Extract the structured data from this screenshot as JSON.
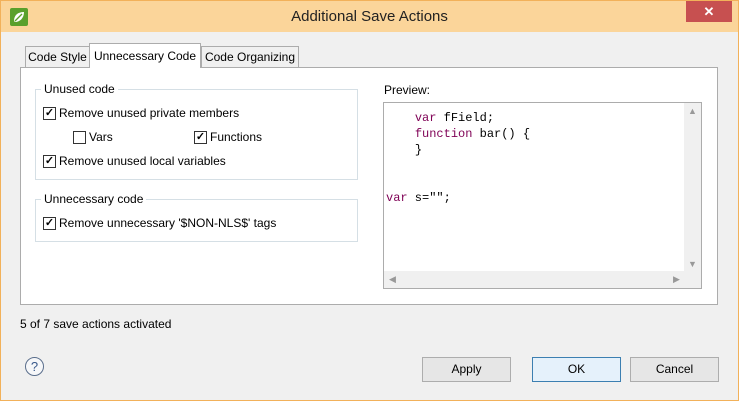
{
  "window": {
    "title": "Additional Save Actions",
    "close_glyph": "✕",
    "app_icon": "eclipse-leaf-icon"
  },
  "tabs": [
    {
      "label": "Code Style",
      "active": false
    },
    {
      "label": "Unnecessary Code",
      "active": true
    },
    {
      "label": "Code Organizing",
      "active": false
    }
  ],
  "unused_group": {
    "title": "Unused code",
    "remove_private": {
      "label": "Remove unused private members",
      "checked": true
    },
    "vars": {
      "label": "Vars",
      "checked": false
    },
    "functions": {
      "label": "Functions",
      "checked": true
    },
    "remove_locals": {
      "label": "Remove unused local variables",
      "checked": true
    }
  },
  "unnecessary_group": {
    "title": "Unnecessary code",
    "remove_nls": {
      "label": "Remove unnecessary '$NON-NLS$' tags",
      "checked": true
    }
  },
  "preview": {
    "label": "Preview:",
    "line1_kw": "var",
    "line1_rest": " fField;",
    "line2_kw": "function",
    "line2_rest": " bar() {",
    "line3": "}",
    "line4_kw": "var",
    "line4_rest": " s=\"\";"
  },
  "status": "5 of 7 save actions activated",
  "buttons": {
    "help": "?",
    "apply": "Apply",
    "ok": "OK",
    "cancel": "Cancel"
  },
  "colors": {
    "titlebar": "#fbd59a",
    "border": "#f2b15a",
    "keyword": "#7f0055",
    "close": "#c75050"
  }
}
